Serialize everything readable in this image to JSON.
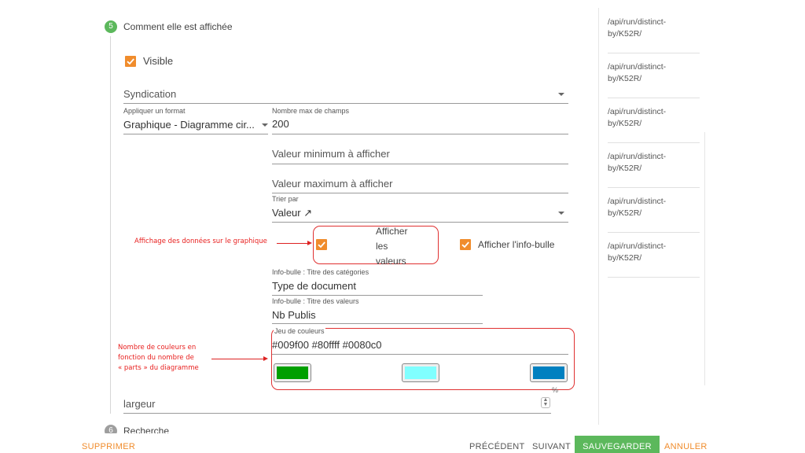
{
  "step5": {
    "number": "5",
    "title": "Comment elle est affichée"
  },
  "step6": {
    "number": "6",
    "title": "Recherche"
  },
  "visible": {
    "label": "Visible",
    "checked": true
  },
  "syndication": {
    "value": "Syndication"
  },
  "format": {
    "label": "Appliquer un format",
    "value": "Graphique - Diagramme cir..."
  },
  "max_fields": {
    "label": "Nombre max de champs",
    "value": "200"
  },
  "min_value": {
    "placeholder": "Valeur minimum à afficher"
  },
  "max_value": {
    "placeholder": "Valeur maximum à afficher"
  },
  "sort": {
    "label": "Trier par",
    "value": "Valeur ↗"
  },
  "show_values": {
    "label_line1": "Afficher",
    "label_line2": "les",
    "label_line3": "valeurs",
    "checked": true
  },
  "show_tooltip": {
    "label": "Afficher l'info-bulle",
    "checked": true
  },
  "tooltip_categories": {
    "label": "Info-bulle : Titre des catégories",
    "value": "Type de document"
  },
  "tooltip_values": {
    "label": "Info-bulle : Titre des valeurs",
    "value": "Nb Publis"
  },
  "color_set": {
    "label": "Jeu de couleurs",
    "value": "#009f00 #80ffff #0080c0",
    "swatches": [
      "#009f00",
      "#80ffff",
      "#0080c0"
    ],
    "unit": "%"
  },
  "width": {
    "placeholder": "largeur"
  },
  "annotations": {
    "data_display": "Affichage des données sur le graphique",
    "colors_line1": "Nombre de couleurs en",
    "colors_line2": "fonction du nombre de",
    "colors_line3": "« parts » du diagramme"
  },
  "sidebar": {
    "items": [
      {
        "line1": "/api/run/distinct-",
        "line2": "by/K52R/"
      },
      {
        "line1": "/api/run/distinct-",
        "line2": "by/K52R/"
      },
      {
        "line1": "/api/run/distinct-",
        "line2": "by/K52R/"
      },
      {
        "line1": "/api/run/distinct-",
        "line2": "by/K52R/"
      },
      {
        "line1": "/api/run/distinct-",
        "line2": "by/K52R/"
      },
      {
        "line1": "/api/run/distinct-",
        "line2": "by/K52R/"
      }
    ]
  },
  "footer": {
    "delete": "SUPPRIMER",
    "previous": "PRÉCÉDENT",
    "next": "SUIVANT",
    "save": "SAUVEGARDER",
    "cancel": "ANNULER"
  },
  "colors": {
    "accent": "#f08c2c",
    "success": "#5cb85c",
    "annotation": "#e8201f"
  }
}
